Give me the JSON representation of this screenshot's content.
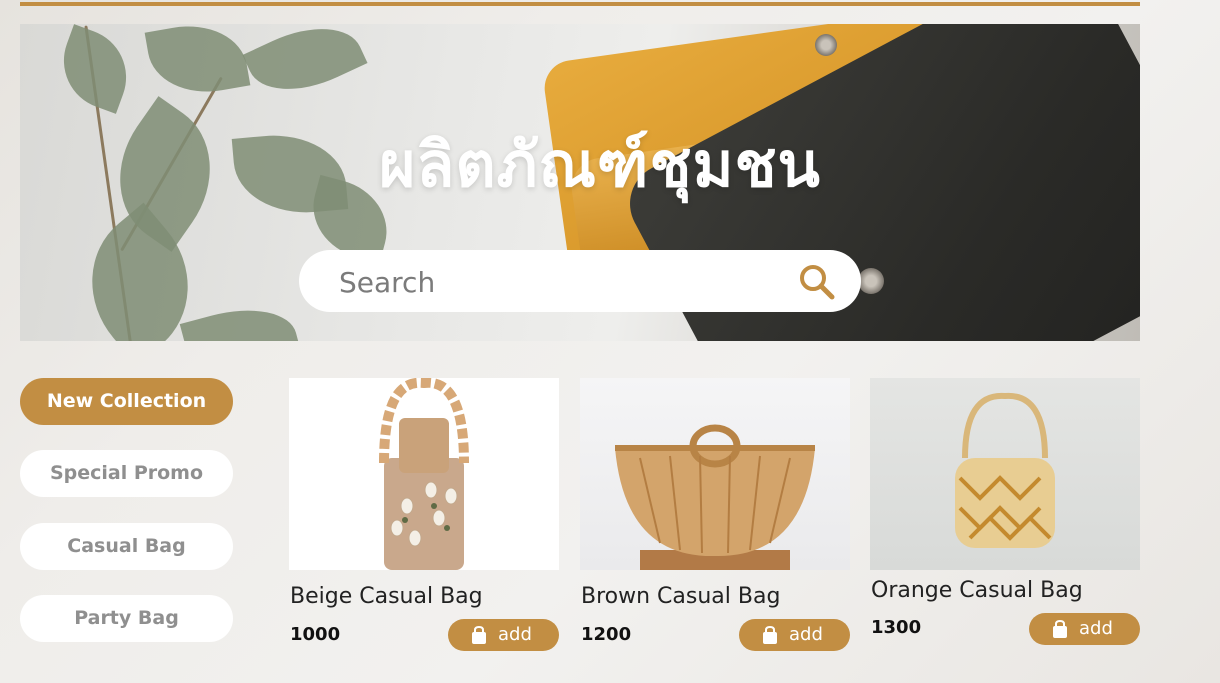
{
  "hero": {
    "title": "ผลิตภัณฑ์ชุมชน",
    "search_placeholder": "Search"
  },
  "categories": [
    {
      "label": "New Collection",
      "active": true
    },
    {
      "label": "Special Promo",
      "active": false
    },
    {
      "label": "Casual Bag",
      "active": false
    },
    {
      "label": "Party Bag",
      "active": false
    }
  ],
  "products": [
    {
      "name": "Beige Casual Bag",
      "price": "1000",
      "add_label": "add"
    },
    {
      "name": "Brown Casual Bag",
      "price": "1200",
      "add_label": "add"
    },
    {
      "name": "Orange Casual Bag",
      "price": "1300",
      "add_label": "add"
    }
  ],
  "colors": {
    "accent": "#c28e43",
    "muted_text": "#8f8f8f"
  },
  "icons": {
    "search": "search-icon",
    "cart": "shopping-bag-icon"
  }
}
